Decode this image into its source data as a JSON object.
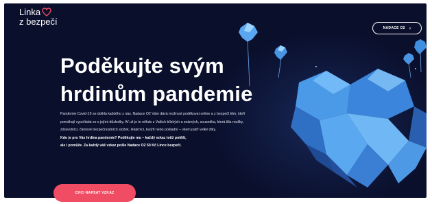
{
  "logo": {
    "line1": "Linka",
    "line2": "z bezpečí"
  },
  "header": {
    "nav_button_label": "NADACE O2",
    "nav_button_icon": "chevron-right-icon"
  },
  "hero": {
    "title_line1": "Poděkujte svým",
    "title_line2": "hrdinům pandemie",
    "paragraph": "Pandemie Covid-19 se dotkla každého z nás. Nadace O2 Vám dává možnost poděkovat online a z bezpečí těm, kteří pomáhají vypořádat se s jejími důsledky. Ať už je to někdo z Vašich blízkých a známých, sousedka, která šila roušky, zdravotníci, členové bezpečnostních složek, lékárníci, kurýři nebo pokladní – všem patří velké díky.",
    "bold_line1": "Kdo je pro Vás hrdina pandemie? Poděkujte mu – každý vzkaz totiž potěší,",
    "bold_line2": "ale i pomůže. Za každý váš vzkaz pošle Nadace O2 50 Kč Lince bezpečí.",
    "cta_label": "CHCI NAPSAT VZKAZ"
  },
  "colors": {
    "background": "#0a0f2c",
    "accent": "#f04c63",
    "heart_blue": "#3f8fe0"
  },
  "icons": [
    "logo-heart-icon",
    "chevron-right-icon",
    "polygon-heart-art",
    "heart-balloon-icon"
  ]
}
